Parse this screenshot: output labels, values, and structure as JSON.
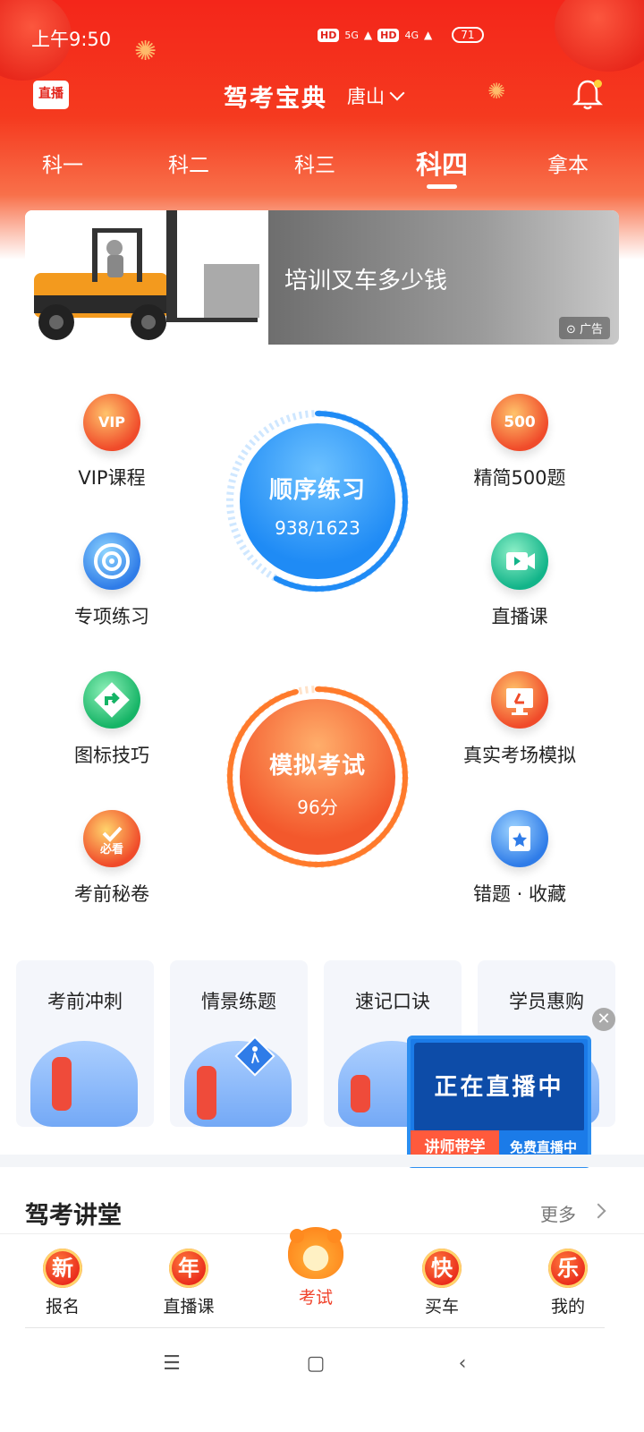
{
  "status_bar": {
    "time": "上午9:50",
    "hd": "HD",
    "net1": "5G",
    "net2": "4G",
    "battery": "71"
  },
  "header": {
    "live_tag": "直播",
    "title": "驾考宝典",
    "city": "唐山"
  },
  "tabs": [
    {
      "label": "科一"
    },
    {
      "label": "科二"
    },
    {
      "label": "科三"
    },
    {
      "label": "科四"
    },
    {
      "label": "拿本"
    }
  ],
  "active_tab": "科四",
  "banner": {
    "text": "培训叉车多少钱",
    "ad_label": "广告"
  },
  "features": {
    "vip": {
      "label": "VIP课程",
      "glyph": "VIP"
    },
    "jingjian": {
      "label": "精简500题",
      "glyph": "500"
    },
    "zhuanxiang": {
      "label": "专项练习"
    },
    "zhibo": {
      "label": "直播课"
    },
    "tubiao": {
      "label": "图标技巧"
    },
    "zhenshi": {
      "label": "真实考场模拟"
    },
    "mijuan": {
      "label": "考前秘卷",
      "glyph": "必看"
    },
    "cuoti": {
      "label": "错题 · 收藏"
    }
  },
  "sequential": {
    "title": "顺序练习",
    "progress_text": "938/1623",
    "done": 938,
    "total": 1623
  },
  "mock_exam": {
    "title": "模拟考试",
    "score_text": "96分",
    "score": 96
  },
  "quick_cards": [
    {
      "title": "考前冲刺"
    },
    {
      "title": "情景练题"
    },
    {
      "title": "速记口诀"
    },
    {
      "title": "学员惠购"
    }
  ],
  "live_popup": {
    "main": "正在直播中",
    "left": "讲师带学",
    "right": "免费直播中"
  },
  "section": {
    "title": "驾考讲堂",
    "more": "更多"
  },
  "bottom_nav": [
    {
      "badge": "新",
      "label": "报名"
    },
    {
      "badge": "年",
      "label": "直播课"
    },
    {
      "badge": "",
      "label": "考试"
    },
    {
      "badge": "快",
      "label": "买车"
    },
    {
      "badge": "乐",
      "label": "我的"
    }
  ],
  "colors": {
    "accent": "#f0432b",
    "blue": "#1f8bf5",
    "orange": "#ff6a2b"
  }
}
